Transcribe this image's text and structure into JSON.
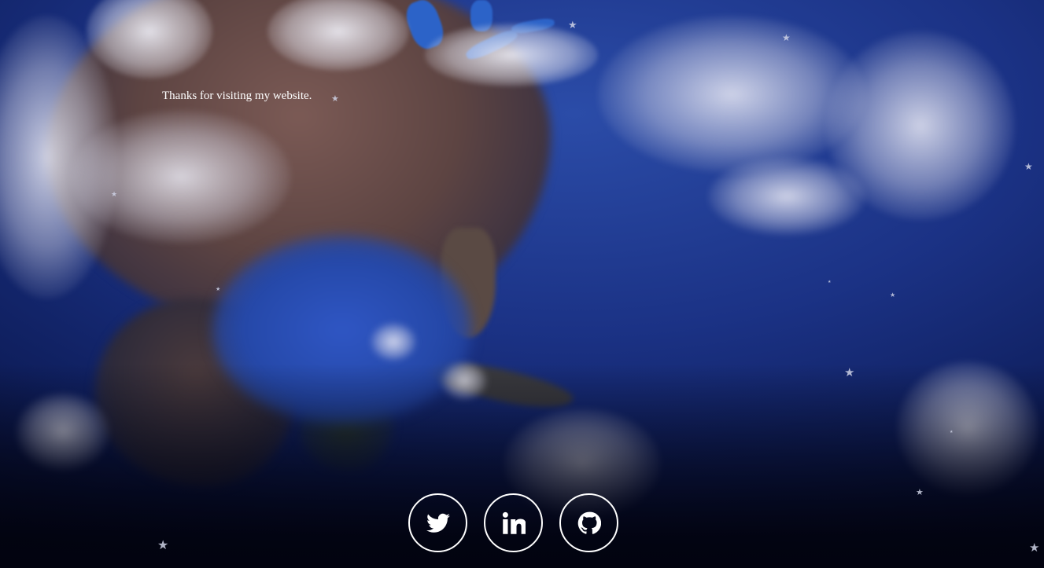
{
  "page": {
    "message": "Thanks for visiting my website."
  },
  "social_links": [
    {
      "name": "twitter",
      "icon": "twitter-icon"
    },
    {
      "name": "linkedin",
      "icon": "linkedin-icon"
    },
    {
      "name": "github",
      "icon": "github-icon"
    }
  ],
  "colors": {
    "background": "#02030f",
    "ocean": "#1b3285",
    "text": "#ffffff",
    "icon_ring": "#ffffff"
  }
}
